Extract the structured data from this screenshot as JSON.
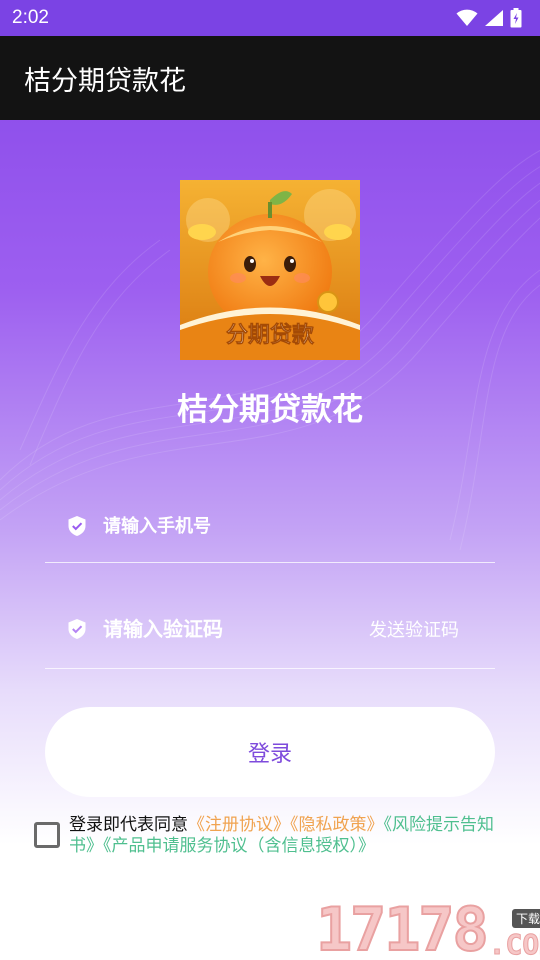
{
  "status_bar": {
    "time": "2:02"
  },
  "app_bar": {
    "title": "桔分期贷款花"
  },
  "logo": {
    "banner_text": "分期贷款"
  },
  "app_name": "桔分期贷款花",
  "login_form": {
    "phone_placeholder": "请输入手机号",
    "code_placeholder": "请输入验证码",
    "send_code_label": "发送验证码",
    "login_label": "登录"
  },
  "agreement": {
    "prefix": "登录即代表同意",
    "links": [
      "《注册协议》",
      "《隐私政策》",
      "《风险提示告知书》",
      "《产品申请服务协议（含信息授权）》"
    ],
    "checked": false
  },
  "watermark": {
    "digits": "17178",
    "badge": "下载站",
    "suffix": ".COM"
  },
  "colors": {
    "status_bar": "#7b43e4",
    "app_bar": "#131313",
    "gradient_top": "#8646e8",
    "login_text": "#7e4bdc",
    "link_orange": "#f0a350",
    "link_teal": "#4fbf8f"
  }
}
